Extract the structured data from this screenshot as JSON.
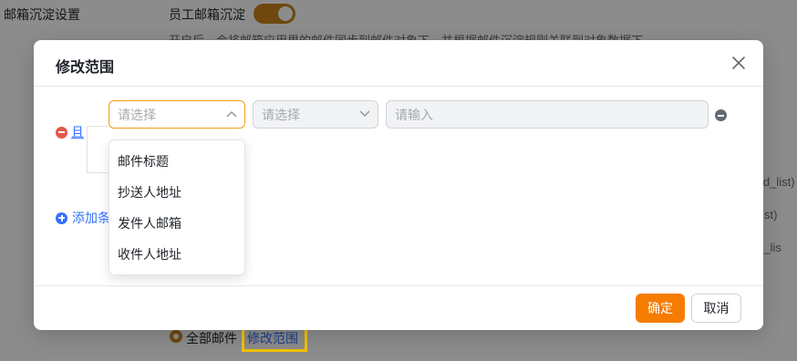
{
  "background": {
    "settings_title": "邮箱沉淀设置",
    "toggle_label": "员工邮箱沉淀",
    "description": "开启后，会将邮箱应用里的邮件同步到邮件对象下，并根据邮件沉淀规则关联到对象数据下",
    "code_fragments": [
      "_list)",
      "id_list)",
      "st)",
      "_id_lis"
    ],
    "radio_label": "全部邮件",
    "edit_scope_link": "修改范围"
  },
  "modal": {
    "title": "修改范围",
    "condition": {
      "operator_label": "且",
      "field_placeholder": "请选择",
      "operator_placeholder": "请选择",
      "value_placeholder": "请输入"
    },
    "dropdown_options": [
      "邮件标题",
      "抄送人地址",
      "发件人邮箱",
      "收件人地址"
    ],
    "add_condition_label": "添加条件",
    "confirm_label": "确定",
    "cancel_label": "取消"
  },
  "colors": {
    "accent": "#f57c00",
    "link": "#3370ff",
    "danger": "#e5554e",
    "highlight": "#f2c200"
  }
}
